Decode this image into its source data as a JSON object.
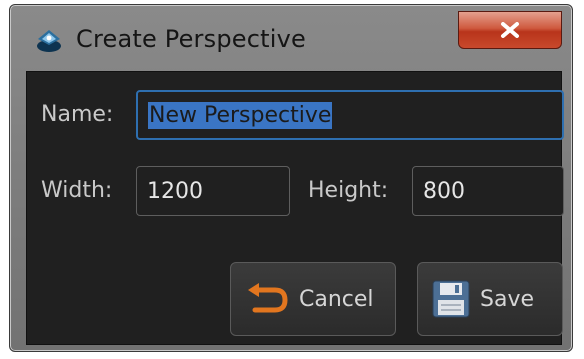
{
  "dialog": {
    "title": "Create Perspective",
    "close_icon": "close-icon"
  },
  "form": {
    "name_label": "Name:",
    "name_value": "New Perspective",
    "width_label": "Width:",
    "width_value": "1200",
    "height_label": "Height:",
    "height_value": "800"
  },
  "buttons": {
    "cancel_label": "Cancel",
    "cancel_icon": "undo-arrow-icon",
    "save_label": "Save",
    "save_icon": "floppy-disk-icon"
  },
  "colors": {
    "selection": "#3a75c4",
    "close_button": "#c8492c",
    "cancel_arrow": "#e2761f"
  }
}
